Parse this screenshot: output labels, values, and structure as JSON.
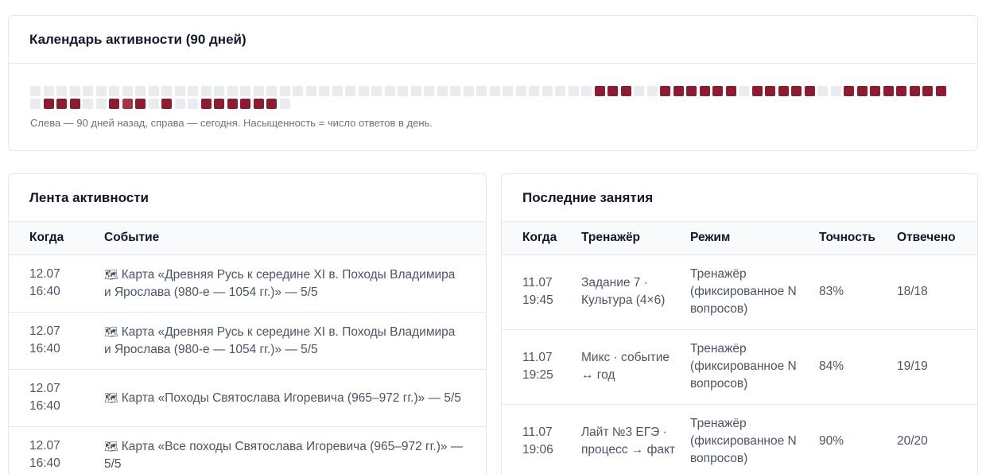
{
  "calendar": {
    "title": "Календарь активности (90 дней)",
    "caption": "Слева — 90 дней назад, справа — сегодня. Насыщенность = число ответов в день.",
    "empty_color": "#eaebef",
    "levels": {
      "1": "#8b1c31",
      "2": "#a23549"
    },
    "days": [
      0,
      0,
      0,
      0,
      0,
      0,
      0,
      0,
      0,
      0,
      0,
      0,
      0,
      0,
      0,
      0,
      0,
      0,
      0,
      0,
      0,
      0,
      0,
      0,
      0,
      0,
      0,
      0,
      0,
      0,
      0,
      0,
      0,
      0,
      0,
      0,
      0,
      0,
      0,
      0,
      0,
      0,
      0,
      1,
      1,
      1,
      0,
      0,
      1,
      1,
      1,
      1,
      1,
      1,
      0,
      1,
      1,
      1,
      1,
      1,
      0,
      0,
      1,
      1,
      1,
      1,
      1,
      1,
      1,
      1,
      0,
      1,
      1,
      1,
      0,
      0,
      1,
      2,
      1,
      0,
      1,
      0,
      0,
      1,
      1,
      1,
      1,
      1,
      1,
      0
    ]
  },
  "feed": {
    "title": "Лента активности",
    "columns": [
      "Когда",
      "Событие"
    ],
    "icon": "🗺",
    "rows": [
      {
        "date": "12.07",
        "time": "16:40",
        "event": "Карта «Древняя Русь к середине XI в. Походы Владимира и Ярослава (980-е — 1054 гг.)» — 5/5"
      },
      {
        "date": "12.07",
        "time": "16:40",
        "event": "Карта «Древняя Русь к середине XI в. Походы Владимира и Ярослава (980-е — 1054 гг.)» — 5/5"
      },
      {
        "date": "12.07",
        "time": "16:40",
        "event": "Карта «Походы Святослава Игоревича (965–972 гг.)» — 5/5"
      },
      {
        "date": "12.07",
        "time": "16:40",
        "event": "Карта «Все походы Святослава Игоревича (965–972 гг.)» — 5/5"
      }
    ]
  },
  "sessions": {
    "title": "Последние занятия",
    "columns": [
      "Когда",
      "Тренажёр",
      "Режим",
      "Точность",
      "Отвечено"
    ],
    "rows": [
      {
        "date": "11.07",
        "time": "19:45",
        "trainer": "Задание 7 · Культура (4×6)",
        "mode": "Тренажёр (фиксированное N вопросов)",
        "accuracy": "83%",
        "answered": "18/18"
      },
      {
        "date": "11.07",
        "time": "19:25",
        "trainer": "Микс · событие ↔ год",
        "mode": "Тренажёр (фиксированное N вопросов)",
        "accuracy": "84%",
        "answered": "19/19"
      },
      {
        "date": "11.07",
        "time": "19:06",
        "trainer": "Лайт №3 ЕГЭ · процесс → факт",
        "mode": "Тренажёр (фиксированное N вопросов)",
        "accuracy": "90%",
        "answered": "20/20"
      }
    ]
  }
}
